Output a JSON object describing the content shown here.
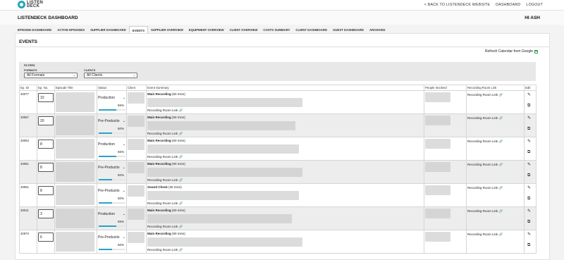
{
  "brand": {
    "logo_text": "LISTEN DECK",
    "logo_icon": "listendeck-logo-icon"
  },
  "toplinks": {
    "back": "< BACK TO LISTENDECK WEBSITE",
    "dashboard": "DASHBOARD",
    "logout": "LOGOUT"
  },
  "header": {
    "title": "LISTENDECK DASHBOARD",
    "greeting": "HI ASH"
  },
  "tabs": [
    {
      "label": "EPISODE DASHBOARD",
      "active": false
    },
    {
      "label": "ACTIVE EPISODES",
      "active": false
    },
    {
      "label": "SUPPLIER DASHBOARD",
      "active": false
    },
    {
      "label": "EVENTS",
      "active": true
    },
    {
      "label": "SUPPLIER OVERVIEW",
      "active": false
    },
    {
      "label": "EQUIPMENT OVERVIEW",
      "active": false
    },
    {
      "label": "CLIENT OVERVIEW",
      "active": false
    },
    {
      "label": "COSTS SUMMARY",
      "active": false
    },
    {
      "label": "CLIENT DASHBOARD",
      "active": false
    },
    {
      "label": "GUEST DASHBOARD",
      "active": false
    },
    {
      "label": "ARCHIVED",
      "active": false
    }
  ],
  "events": {
    "title": "EVENTS",
    "refresh_label": "Refresh Calendar from Google",
    "filters": {
      "label": "FILTERS",
      "formats_label": "FORMATS",
      "formats_value": "All Formats",
      "clients_label": "CLIENTS",
      "clients_value": "All Clients"
    },
    "columns": [
      "Ep. ID",
      "Ep. No.",
      "Episode Title",
      "Status",
      "Client",
      "Event Summary",
      "People Involved",
      "Recording Room Link",
      "Edit"
    ],
    "rows": [
      {
        "ep_id": "33077",
        "ep_no": "10",
        "status": "Production",
        "pct": "65%",
        "progress": 0.65,
        "event_name": "Main Recording",
        "duration": "(60 mins)",
        "rr_link": "Recording Room Link",
        "rec_link": "Recording Room Link"
      },
      {
        "ep_id": "33067",
        "ep_no": "20",
        "status": "Pre-Productio",
        "pct": "50%",
        "progress": 0.5,
        "event_name": "Main Recording",
        "duration": "(60 mins)",
        "rr_link": "Recording Room Link",
        "rec_link": "Recording Room Link"
      },
      {
        "ep_id": "33053",
        "ep_no": "8",
        "status": "Production",
        "pct": "65%",
        "progress": 0.65,
        "event_name": "Main Recording",
        "duration": "(60 mins)",
        "rr_link": "Recording Room Link",
        "rec_link": "Recording Room Link"
      },
      {
        "ep_id": "33051",
        "ep_no": "8",
        "status": "Pre-Productio",
        "pct": "50%",
        "progress": 0.5,
        "event_name": "Main Recording",
        "duration": "(90 mins)",
        "rr_link": "Recording Room Link",
        "rec_link": "Recording Room Link"
      },
      {
        "ep_id": "33051",
        "ep_no": "8",
        "status": "Pre-Productio",
        "pct": "50%",
        "progress": 0.5,
        "event_name": "Sound Check",
        "duration": "(30 mins)",
        "rr_link": "Recording Room Link",
        "rec_link": "Recording Room Link"
      },
      {
        "ep_id": "33011",
        "ep_no": "3",
        "status": "Production",
        "pct": "65%",
        "progress": 0.65,
        "event_name": "Main Recording",
        "duration": "(60 mins)",
        "rr_link": "Recording Room Link",
        "rec_link": "Recording Room Link"
      },
      {
        "ep_id": "32973",
        "ep_no": "6",
        "status": "Pre-Productio",
        "pct": "50%",
        "progress": 0.5,
        "event_name": "Main Recording",
        "duration": "(90 mins)",
        "rr_link": "Recording Room Link",
        "rec_link": "Recording Room Link"
      }
    ]
  },
  "colors": {
    "accent": "#29a3c5",
    "brand": "#2aa6b4",
    "google_green": "#2a9d4a"
  }
}
